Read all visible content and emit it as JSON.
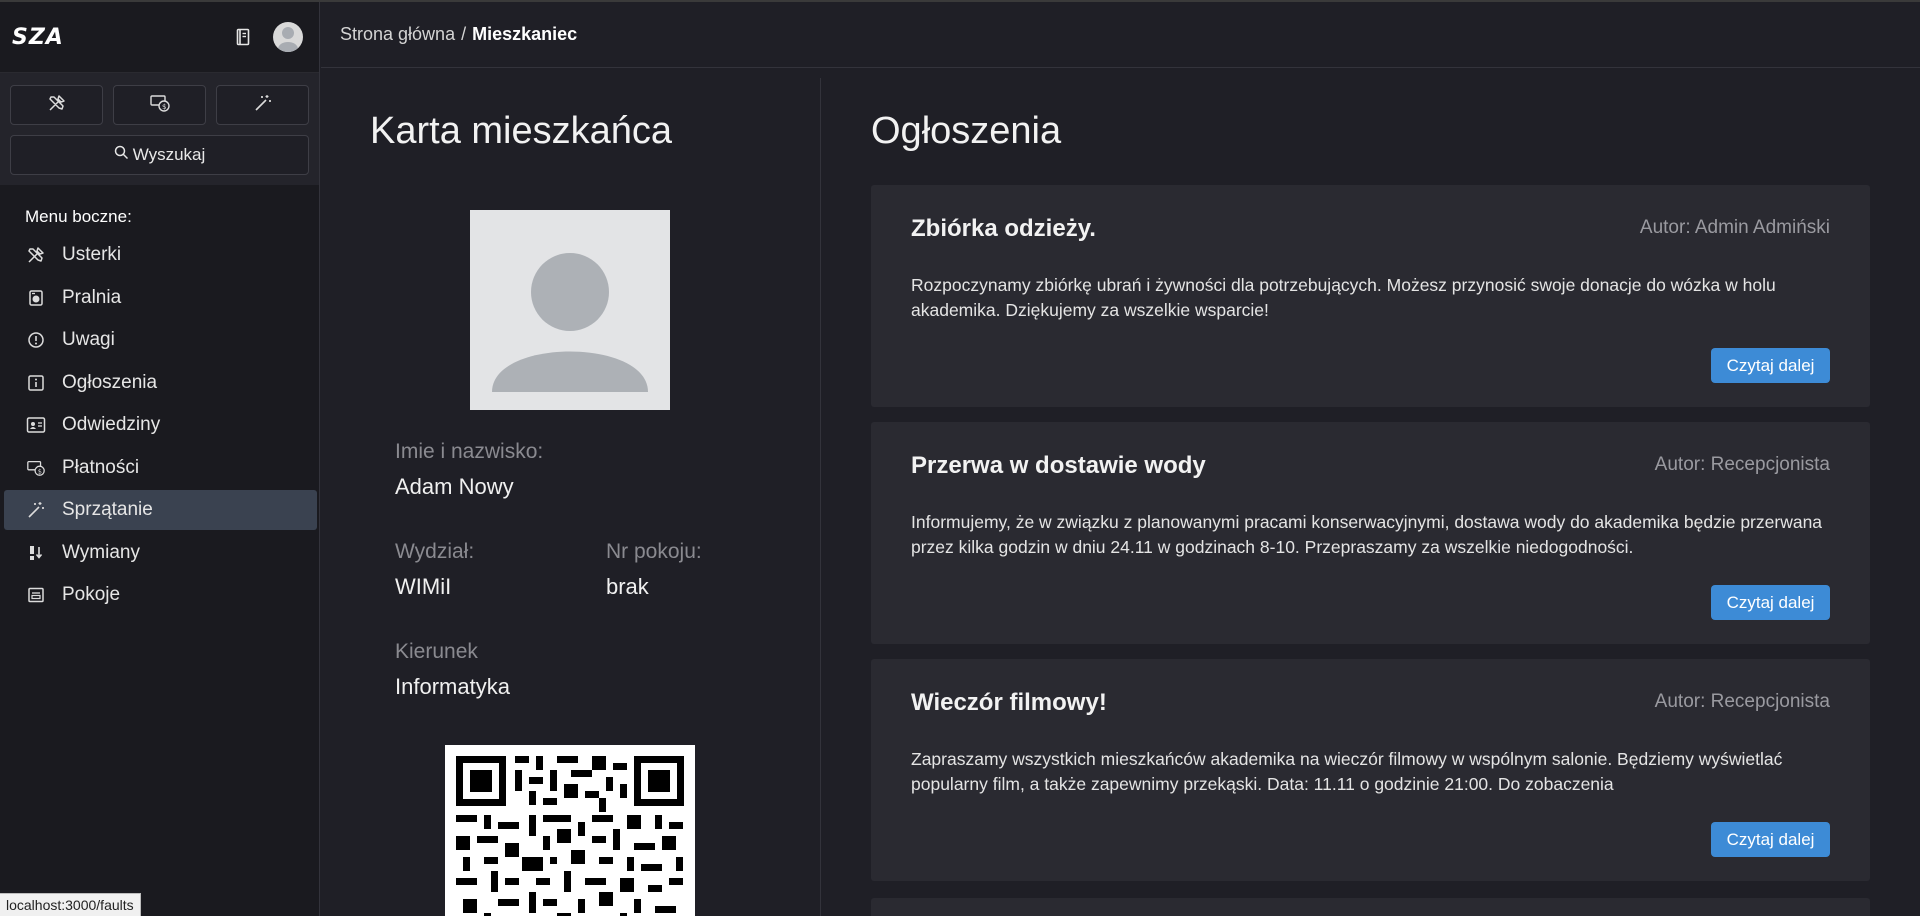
{
  "app": {
    "logo": "SZA"
  },
  "sidebar": {
    "search_label": "Wyszukaj",
    "menu_heading": "Menu boczne:",
    "items": [
      {
        "label": "Usterki",
        "icon": "tools-icon"
      },
      {
        "label": "Pralnia",
        "icon": "washing-machine-icon"
      },
      {
        "label": "Uwagi",
        "icon": "exclamation-circle-icon"
      },
      {
        "label": "Ogłoszenia",
        "icon": "info-square-icon"
      },
      {
        "label": "Odwiedziny",
        "icon": "person-card-icon"
      },
      {
        "label": "Płatności",
        "icon": "cash-coin-icon"
      },
      {
        "label": "Sprzątanie",
        "icon": "magic-wand-icon",
        "active": true
      },
      {
        "label": "Wymiany",
        "icon": "exchange-icon"
      },
      {
        "label": "Pokoje",
        "icon": "room-icon"
      }
    ]
  },
  "status_bar": {
    "url": "localhost:3000/faults"
  },
  "breadcrumb": {
    "home": "Strona główna",
    "separator": "/",
    "current": "Mieszkaniec"
  },
  "resident": {
    "title": "Karta mieszkańca",
    "name_label": "Imie i nazwisko:",
    "name_value": "Adam Nowy",
    "faculty_label": "Wydział:",
    "faculty_value": "WIMiI",
    "room_label": "Nr pokoju:",
    "room_value": "brak",
    "major_label": "Kierunek",
    "major_value": "Informatyka"
  },
  "announcements": {
    "title": "Ogłoszenia",
    "read_more": "Czytaj dalej",
    "items": [
      {
        "title": "Zbiórka odzieży.",
        "author": "Autor: Admin Admiński",
        "body": "Rozpoczynamy zbiórkę ubrań i żywności dla potrzebujących. Możesz przynosić swoje donacje do wózka w holu akademika. Dziękujemy za wszelkie wsparcie!"
      },
      {
        "title": "Przerwa w dostawie wody",
        "author": "Autor: Recepcjonista",
        "body": "Informujemy, że w związku z planowanymi pracami konserwacyjnymi, dostawa wody do akademika będzie przerwana przez kilka godzin w dniu 24.11 w godzinach 8-10. Przepraszamy za wszelkie niedogodności."
      },
      {
        "title": "Wieczór filmowy!",
        "author": "Autor: Recepcjonista",
        "body": "Zapraszamy wszystkich mieszkańców akademika na wieczór filmowy w wspólnym salonie. Będziemy wyświetlać popularny film, a także zapewnimy przekąski. Data: 11.11 o godzinie 21:00. Do zobaczenia"
      }
    ]
  },
  "colors": {
    "background": "#1f1f26",
    "sidebar": "#1a1a1f",
    "card": "#2a2a31",
    "accent": "#3d8bd6",
    "active_item": "#3a4250"
  }
}
